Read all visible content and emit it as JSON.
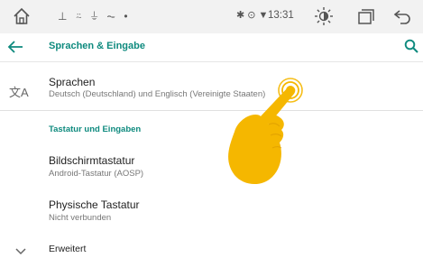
{
  "status_bar": {
    "notification_glyphs": "⊥ ⍨ ⏚ ⏦ •",
    "right_icons": "✱ ⊙ ▼",
    "time": "13:31"
  },
  "app_bar": {
    "title": "Sprachen & Eingabe"
  },
  "settings": {
    "languages": {
      "title": "Sprachen",
      "subtitle": "Deutsch (Deutschland) und Englisch (Vereinigte Staaten)",
      "icon_glyph": "文A"
    },
    "section_header": "Tastatur und Eingaben",
    "onscreen_keyboard": {
      "title": "Bildschirmtastatur",
      "subtitle": "Android-Tastatur (AOSP)"
    },
    "physical_keyboard": {
      "title": "Physische Tastatur",
      "subtitle": "Nicht verbunden"
    },
    "advanced": {
      "title": "Erweitert"
    }
  },
  "colors": {
    "accent": "#0e8a7e",
    "status_bar_bg": "#f2f2f2",
    "hand": "#f5b700",
    "tap_ring": "#f5b700"
  }
}
